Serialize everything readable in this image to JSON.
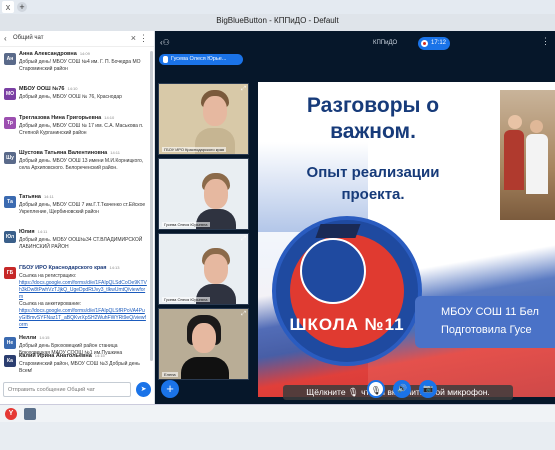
{
  "browser": {
    "tab_icon": "x",
    "new_tab": "+"
  },
  "window": {
    "title": "BigBlueButton - КППиДО - Default"
  },
  "chat": {
    "title": "Общий чат",
    "messages": [
      {
        "initials": "Ан",
        "color": "#5a6a8a",
        "name": "Анна Александровна",
        "time": "14:09",
        "text": "Добрый день! МБОУ СОШ №4 им. Г. П. Бочедра МО Староминский район"
      },
      {
        "initials": "МО",
        "color": "#7a3fa3",
        "name": "МБОУ ООШ №76",
        "time": "14:10",
        "text": "Добрый день, МБОУ ООШ № 76, Краснодар"
      },
      {
        "initials": "Тр",
        "color": "#9c4fb0",
        "name": "Треглазова Нина Григорьевна",
        "time": "14:10",
        "text": "Добрый день, МБОУ СОШ № 17 им. С.А. Маськова п. Степной Курганинский район"
      },
      {
        "initials": "Шу",
        "color": "#5a6a8a",
        "name": "Шустова Татьяна Валентиновна",
        "time": "14:11",
        "text": "Добрый день. МБОУ ООШ 13 имени М.И.Корницкого, села Архиповского. Белореченский район."
      },
      {
        "initials": "Та",
        "color": "#3b6ab0",
        "name": "Татьяна",
        "time": "14:11",
        "text": "Добрый день, МБОУ СОШ 7 им.Г.Т.Ткаченко ст.Ейское Укрепление, Щербиновский район"
      },
      {
        "initials": "Юл",
        "color": "#3a5f8a",
        "name": "Юлия",
        "time": "14:11",
        "text": "Добрый день. МОБУ ООШ№34 СТ.ВЛАДИМИРСКОЙ ЛАБИНСКИЙ РАЙОН"
      },
      {
        "initials": "ГБ",
        "color": "#c62828",
        "name": "ГБОУ ИРО Краснодарского края",
        "time": "14:13",
        "text": "Ссылка на регистрацию:",
        "link1": "https://docs.google.com/forms/d/e/1FAIpQLSdCoOe9KTVh3kDw8tPwhVzTJjkQ_UgeDpdRtJvy3_tlkwUmtQ/viewform",
        "text2": "Ссылка на анкетирование:",
        "link2": "https://docs.google.com/forms/d/e/1FAIpQLSfRPoVA4PuyGIBmvSYFNaz1T_aBQKvrXpSH2WuhFWYRt9eQ/viewform"
      },
      {
        "initials": "Не",
        "color": "#3b6ab0",
        "name": "Нелли",
        "time": "14:15",
        "text": "Добрый день Брюховецкий район станица Брюховецкая МАОУ СООШ №1 им.Пушкина"
      },
      {
        "initials": "Ка",
        "color": "#2c3e70",
        "name": "Калий Ирина Анатольевна",
        "time": "14:15",
        "text": "Староминский район, МБОУ СОШ №3 Добрый день Всем!"
      }
    ],
    "input_placeholder": "Отправить сообщение Общий чат"
  },
  "main": {
    "title": "КППиДО",
    "rec_time": "17:12",
    "talking": "Гусева Олеся Юрье...",
    "videos": [
      {
        "label": "ГБОУ ИРО Краснодарского края"
      },
      {
        "label": "Гусева Олеся Юрьевна"
      },
      {
        "label": "Гусева Олеся Юрьевна"
      },
      {
        "label": "Елена"
      }
    ],
    "slide": {
      "title": "Разговоры о важном.",
      "subtitle": "Опыт реализации проекта.",
      "emblem": "ШКОЛА №11",
      "box_line1": "МБОУ СОШ 11 Бел",
      "box_line2": "Подготовила Гусе"
    },
    "mic_hint": "Щёлкните 🎙 чтобы включить свой микрофон."
  }
}
